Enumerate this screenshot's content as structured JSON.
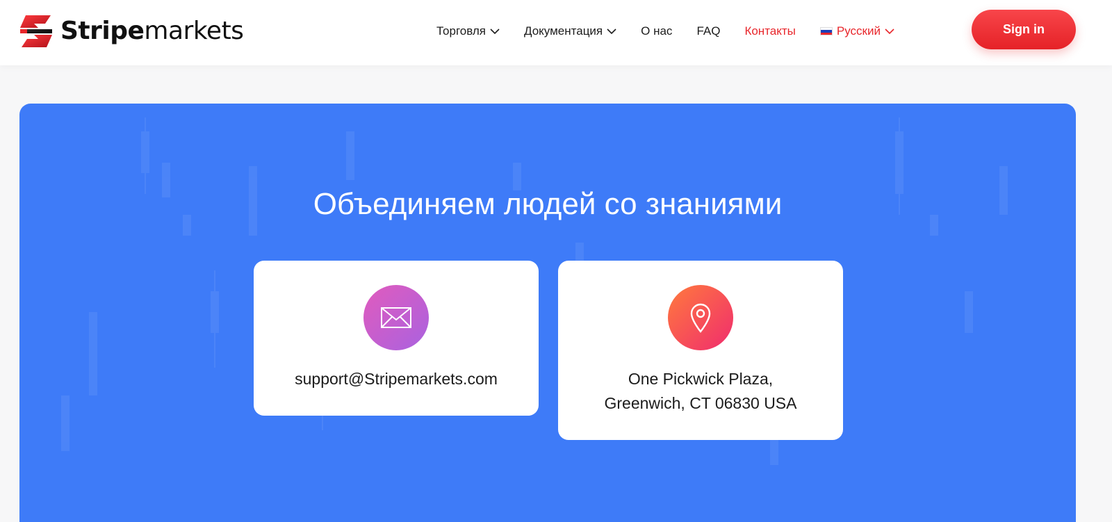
{
  "brand": {
    "name_bold": "Stripe",
    "name_light": "markets",
    "logo_colors": [
      "#e8262b",
      "#111111"
    ]
  },
  "nav": {
    "items": [
      {
        "label": "Торговля",
        "dropdown": true
      },
      {
        "label": "Документация",
        "dropdown": true
      },
      {
        "label": "О нас",
        "dropdown": false
      },
      {
        "label": "FAQ",
        "dropdown": false
      },
      {
        "label": "Контакты",
        "dropdown": false,
        "active": true
      }
    ],
    "language": {
      "label": "Русский",
      "flag": "ru-flag-icon"
    },
    "signin_label": "Sign in"
  },
  "hero": {
    "title": "Объединяем людей со знаниями",
    "background_color": "#3e7bf8",
    "cards": [
      {
        "icon": "envelope-icon",
        "line1": "support@Stripemarkets.com"
      },
      {
        "icon": "location-pin-icon",
        "line1": "One Pickwick Plaza,",
        "line2": "Greenwich, CT 06830 USA"
      }
    ]
  },
  "colors": {
    "accent": "#e8262b",
    "hero_blue": "#3e7bf8"
  }
}
